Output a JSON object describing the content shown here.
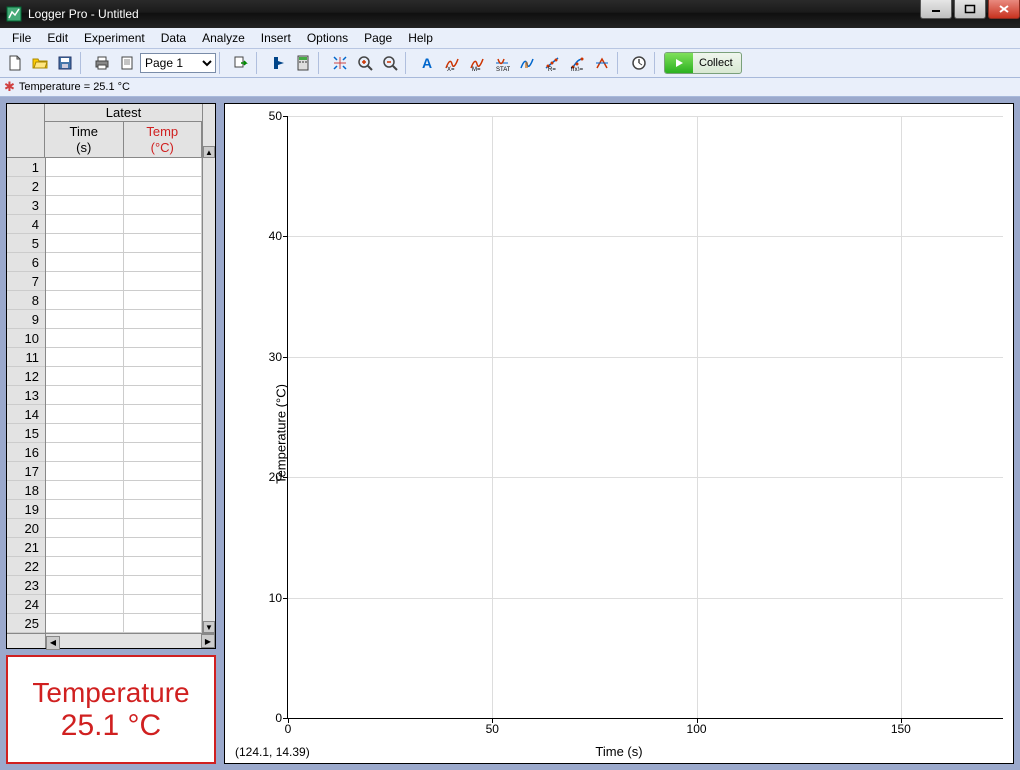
{
  "window": {
    "title": "Logger Pro - Untitled"
  },
  "menus": [
    "File",
    "Edit",
    "Experiment",
    "Data",
    "Analyze",
    "Insert",
    "Options",
    "Page",
    "Help"
  ],
  "page_select": "Page 1",
  "collect_label": "Collect",
  "info_bar": "Temperature =  25.1 °C",
  "table": {
    "group": "Latest",
    "col1": {
      "name": "Time",
      "unit": "(s)"
    },
    "col2": {
      "name": "Temp",
      "unit": "(°C)"
    },
    "row_count": 25
  },
  "meter": {
    "label": "Temperature",
    "value": "25.1 °C"
  },
  "graph": {
    "xlabel": "Time (s)",
    "ylabel": "Temperature (°C)",
    "cursor": "(124.1, 14.39)",
    "xticks": [
      0,
      50,
      100,
      150
    ],
    "yticks": [
      0,
      10,
      20,
      30,
      40,
      50
    ],
    "xrange": [
      0,
      175
    ],
    "yrange": [
      0,
      50
    ]
  },
  "chart_data": {
    "type": "line",
    "title": "",
    "xlabel": "Time (s)",
    "ylabel": "Temperature (°C)",
    "xlim": [
      0,
      175
    ],
    "ylim": [
      0,
      50
    ],
    "series": [
      {
        "name": "Temperature",
        "x": [],
        "y": []
      }
    ]
  }
}
